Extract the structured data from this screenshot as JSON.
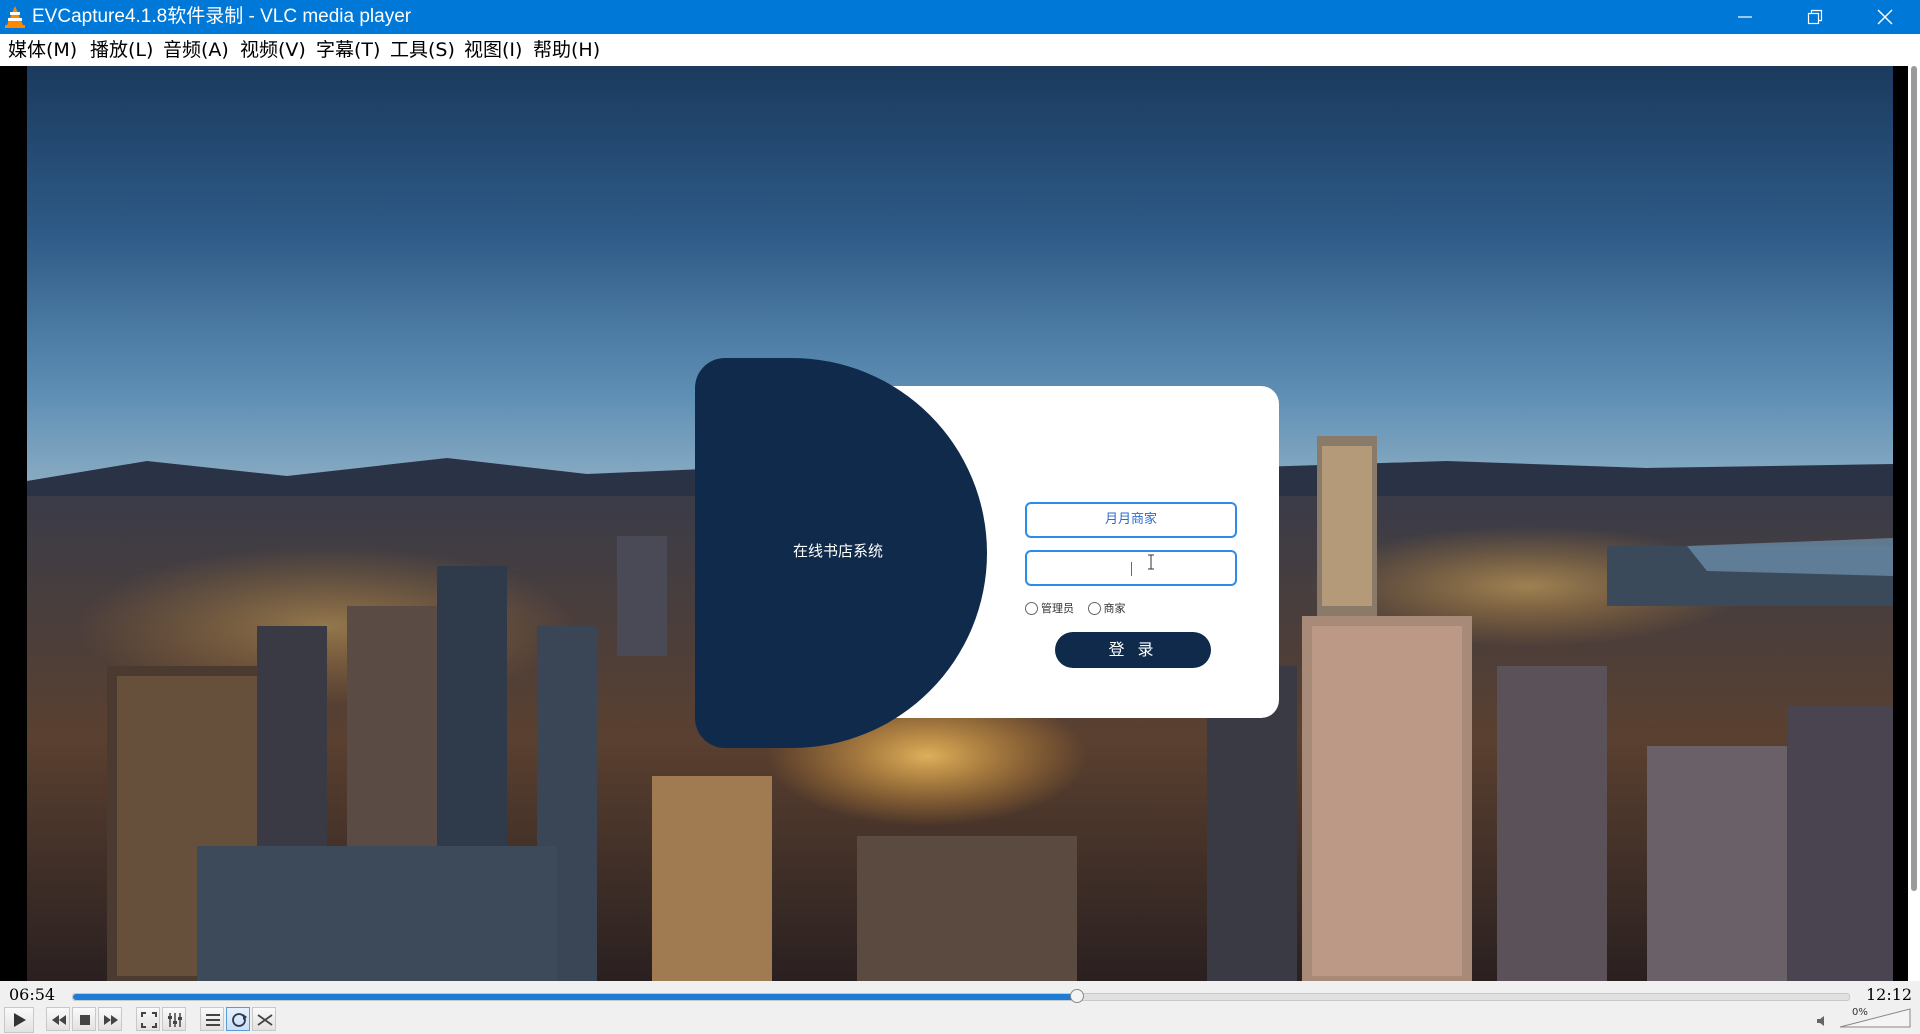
{
  "window": {
    "title": "EVCapture4.1.8软件录制 - VLC media player",
    "icons": [
      "vlc-cone-icon",
      "minimize-icon",
      "restore-icon",
      "close-icon"
    ]
  },
  "menu": {
    "items": [
      "媒体(M)",
      "播放(L)",
      "音频(A)",
      "视频(V)",
      "字幕(T)",
      "工具(S)",
      "视图(I)",
      "帮助(H)"
    ]
  },
  "video": {
    "login": {
      "brand": "在线书店系统",
      "username_value": "月月商家",
      "password_value": "",
      "roles": [
        "管理员",
        "商家"
      ],
      "login_button": "登 录"
    }
  },
  "player": {
    "elapsed": "06:54",
    "total": "12:12",
    "progress": 0.565,
    "volume_label": "0%",
    "controls": [
      "play-icon",
      "previous-icon",
      "stop-icon",
      "next-icon",
      "fullscreen-icon",
      "extended-settings-icon",
      "playlist-icon",
      "loop-icon",
      "shuffle-icon"
    ]
  },
  "colors": {
    "titlebar": "#0078d7",
    "login_panel": "#0f2a4a",
    "input_border": "#2e8ce6",
    "seek_fill": "#1c7cd6"
  }
}
